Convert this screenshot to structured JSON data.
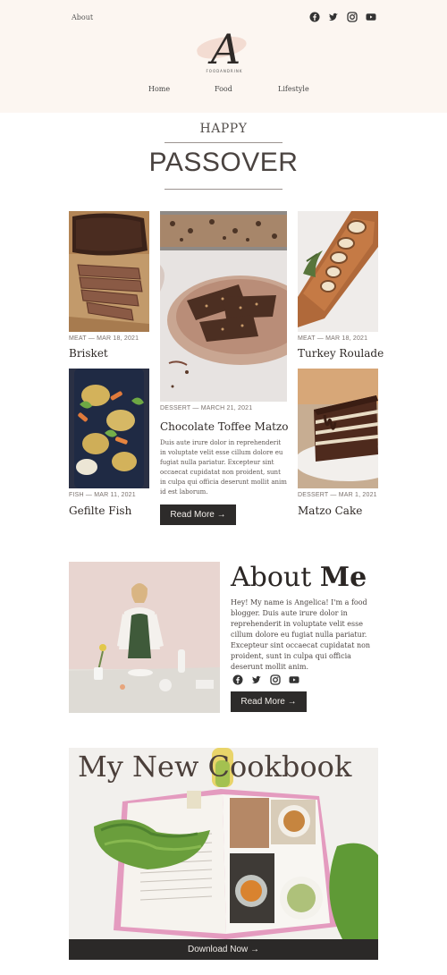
{
  "header": {
    "about_link": "About",
    "logo_letter": "A",
    "logo_text": "FOODANDRINK",
    "nav": [
      {
        "label": "Home"
      },
      {
        "label": "Food"
      },
      {
        "label": "Lifestyle"
      }
    ],
    "social_icons": [
      "facebook-icon",
      "twitter-icon",
      "instagram-icon",
      "youtube-icon"
    ]
  },
  "headline": {
    "kicker": "HAPPY",
    "title": "PASSOVER"
  },
  "posts": {
    "brisket": {
      "meta": "MEAT — MAR 18, 2021",
      "title": "Brisket"
    },
    "gefilte": {
      "meta": "FISH — MAR 11, 2021",
      "title": "Gefilte Fish"
    },
    "matzo": {
      "meta": "DESSERT — MARCH 21, 2021",
      "title": "Chocolate Toffee Matzo",
      "excerpt": "Duis aute irure dolor in reprehenderit in voluptate velit esse cillum dolore eu fugiat nulla pariatur. Excepteur sint occaecat cupidatat non proident, sunt in culpa qui officia deserunt mollit anim id est laborum.",
      "button": "Read More →"
    },
    "turkey": {
      "meta": "MEAT — MAR 18, 2021",
      "title": "Turkey Roulade"
    },
    "cake": {
      "meta": "DESSERT — MAR 1, 2021",
      "title": "Matzo Cake"
    }
  },
  "about": {
    "title_light": "About",
    "title_bold": "Me",
    "text": "Hey! My name is Angelica! I'm a food blogger. Duis aute irure dolor in reprehenderit in voluptate velit esse cillum dolore eu fugiat nulla pariatur. Excepteur sint occaecat cupidatat non proident, sunt in culpa qui officia deserunt mollit anim.",
    "button": "Read More →"
  },
  "cookbook": {
    "title": "My New Cookbook",
    "button": "Download Now →"
  },
  "colors": {
    "header_bg": "#fcf6f1",
    "button_bg": "#2d2b2a",
    "text_dark": "#2e2825"
  }
}
